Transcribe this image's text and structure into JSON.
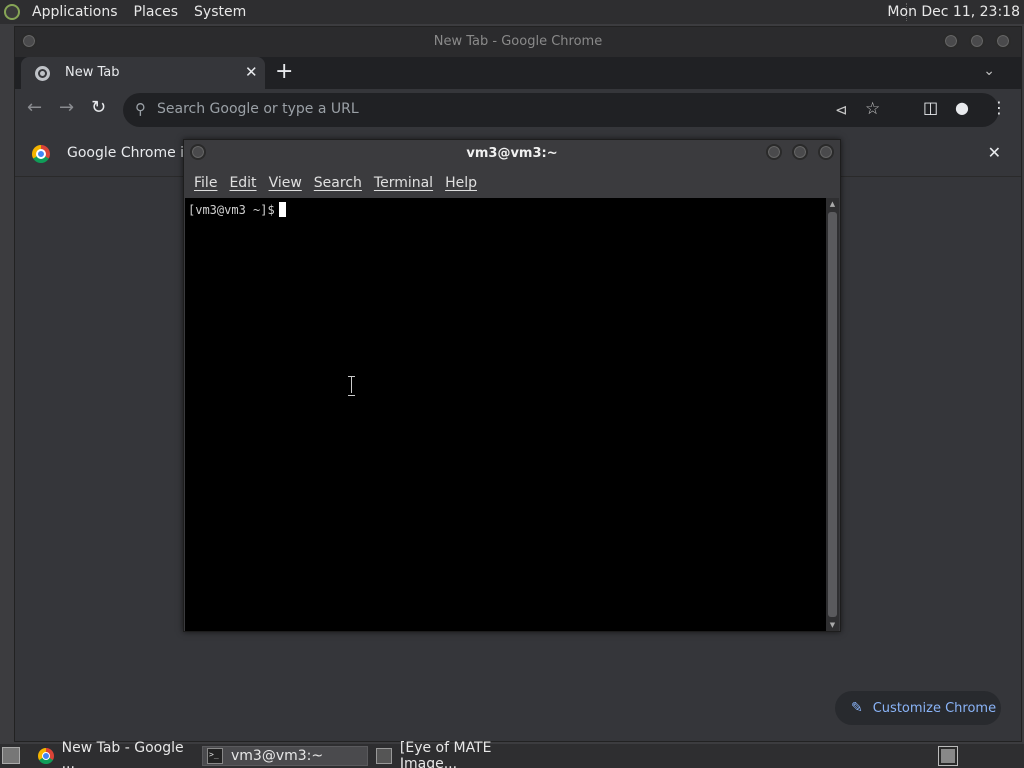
{
  "top_panel": {
    "menus": [
      "Applications",
      "Places",
      "System"
    ],
    "clock": "Mon Dec 11, 23:18",
    "logo_icon": "mate-logo-icon"
  },
  "chrome": {
    "window_title": "New Tab - Google Chrome",
    "tab": {
      "label": "New Tab",
      "close": "✕"
    },
    "new_tab": "+",
    "omnibox_placeholder": "Search Google or type a URL",
    "infobar_message": "Google Chrome isn",
    "customize_label": "Customize Chrome",
    "accent": "#8ab4f8"
  },
  "terminal": {
    "window_title": "vm3@vm3:~",
    "menus": [
      "File",
      "Edit",
      "View",
      "Search",
      "Terminal",
      "Help"
    ],
    "prompt": "[vm3@vm3 ~]$"
  },
  "taskbar": {
    "items": [
      {
        "label": "New Tab - Google ...",
        "icon": "chrome-icon"
      },
      {
        "label": "vm3@vm3:~",
        "icon": "terminal-icon"
      },
      {
        "label": "[Eye of MATE Image...",
        "icon": "image-viewer-icon"
      }
    ]
  }
}
